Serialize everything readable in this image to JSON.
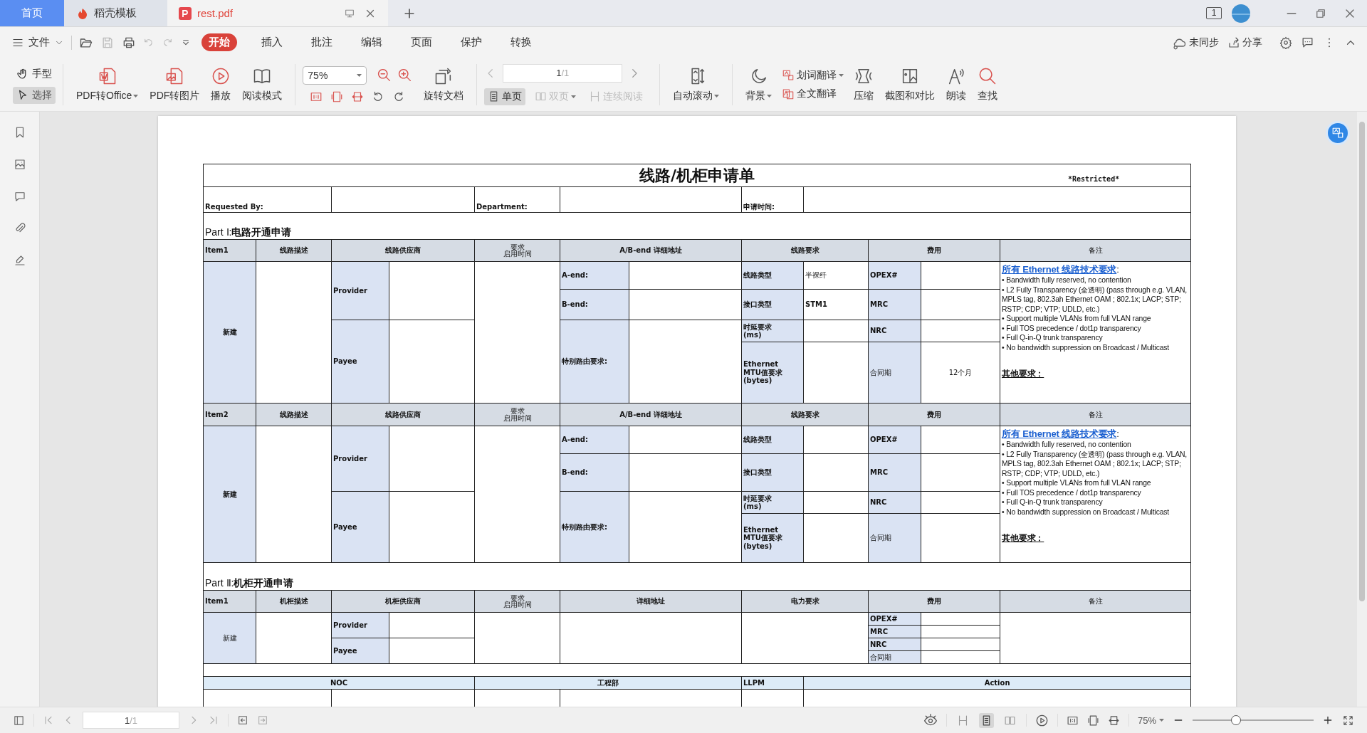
{
  "tabs": [
    {
      "label": "首页",
      "selected": false,
      "kind": "home"
    },
    {
      "label": "稻壳模板",
      "selected": false,
      "kind": "docer"
    },
    {
      "label": "rest.pdf",
      "selected": true,
      "kind": "pdf"
    }
  ],
  "title_bar": {
    "page_badge": "1"
  },
  "menu": {
    "file": "文件",
    "tabs": [
      {
        "label": "开始",
        "selected": true
      },
      {
        "label": "插入",
        "selected": false
      },
      {
        "label": "批注",
        "selected": false
      },
      {
        "label": "编辑",
        "selected": false
      },
      {
        "label": "页面",
        "selected": false
      },
      {
        "label": "保护",
        "selected": false
      },
      {
        "label": "转换",
        "selected": false
      }
    ],
    "sync": "未同步",
    "share": "分享"
  },
  "toolbar": {
    "pointer_tools": [
      {
        "label": "手型",
        "selected": false
      },
      {
        "label": "选择",
        "selected": true
      }
    ],
    "convert": [
      {
        "label": "PDF转Office",
        "dropdown": true
      },
      {
        "label": "PDF转图片",
        "dropdown": false
      },
      {
        "label": "播放",
        "dropdown": false
      },
      {
        "label": "阅读模式",
        "dropdown": false
      }
    ],
    "zoom": "75%",
    "rotate": "旋转文档",
    "page": {
      "current": "1",
      "total": "/1"
    },
    "view_modes": [
      {
        "label": "单页",
        "selected": true,
        "disabled": false,
        "dropdown": false
      },
      {
        "label": "双页",
        "selected": false,
        "disabled": true,
        "dropdown": true
      },
      {
        "label": "连续阅读",
        "selected": false,
        "disabled": true,
        "dropdown": false
      }
    ],
    "tools": [
      {
        "label": "自动滚动",
        "dropdown": true
      },
      {
        "label": "背景",
        "dropdown": true
      }
    ],
    "translate": [
      {
        "label": "划词翻译",
        "dropdown": true
      },
      {
        "label": "全文翻译",
        "dropdown": false
      }
    ],
    "more_tools": [
      {
        "label": "压缩"
      },
      {
        "label": "截图和对比"
      },
      {
        "label": "朗读"
      },
      {
        "label": "查找"
      }
    ]
  },
  "document": {
    "title": "线路/机柜申请单",
    "classification": "*Restricted*",
    "requested_by": "Requested By:",
    "department": "Department:",
    "request_time": "申请时间:",
    "part1_heading": "Part Ⅰ:**电路开通申请**",
    "circuit_items": [
      {
        "item": "Item1",
        "columns": [
          "线路描述",
          "线路供应商",
          "A/B-end 详细地址",
          "线路要求",
          "费用",
          "备注"
        ],
        "time_header": [
          "要求",
          "启用时间"
        ],
        "status": "新建",
        "provider": "Provider",
        "payee": "Payee",
        "a_end": "A-end:",
        "b_end": "B-end:",
        "routing": "特别路由要求:",
        "requirements": [
          {
            "label": "线路类型",
            "value": "半裸纤"
          },
          {
            "label": "接口类型",
            "value": "STM1"
          },
          {
            "label": "时延要求\n(ms)"
          },
          {
            "label": "Ethernet\nMTU值要求\n(bytes)"
          }
        ],
        "fees": [
          {
            "label": "OPEX#"
          },
          {
            "label": "MRC"
          },
          {
            "label": "NRC"
          },
          {
            "label": "合同期",
            "value": "12个月"
          }
        ],
        "remarks": {
          "link": "所有 Ethernet 线路技术要求",
          "link_suffix": ":",
          "bullets": [
            "• Bandwidth fully reserved, no contention",
            "• L2 Fully Transparency (全透明) (pass through e.g. VLAN, MPLS tag, 802.3ah Ethernet OAM ; 802.1x; LACP; STP; RSTP; CDP; VTP; UDLD, etc.)",
            "• Support multiple VLANs from full VLAN range",
            "• Full TOS precedence / dot1p transparency",
            "• Full Q-in-Q trunk transparency",
            "• No bandwidth suppression on Broadcast / Multicast"
          ],
          "other": "其他要求："
        }
      },
      {
        "item": "Item2",
        "columns": [
          "线路描述",
          "线路供应商",
          "A/B-end 详细地址",
          "线路要求",
          "费用",
          "备注"
        ],
        "time_header": [
          "要求",
          "启用时间"
        ],
        "status": "新建",
        "provider": "Provider",
        "payee": "Payee",
        "a_end": "A-end:",
        "b_end": "B-end:",
        "routing": "特别路由要求:",
        "requirements": [
          {
            "label": "线路类型"
          },
          {
            "label": "接口类型"
          },
          {
            "label": "时延要求\n(ms)"
          },
          {
            "label": "Ethernet\nMTU值要求\n(bytes)"
          }
        ],
        "fees": [
          {
            "label": "OPEX#"
          },
          {
            "label": "MRC"
          },
          {
            "label": "NRC"
          },
          {
            "label": "合同期"
          }
        ],
        "remarks": {
          "link": "所有 Ethernet 线路技术要求",
          "link_suffix": ":",
          "bullets": [
            "• Bandwidth fully reserved, no contention",
            "• L2 Fully Transparency (全透明) (pass through e.g. VLAN, MPLS tag, 802.3ah Ethernet OAM ; 802.1x; LACP; STP; RSTP; CDP; VTP; UDLD, etc.)",
            "• Support multiple VLANs from full VLAN range",
            "• Full TOS precedence / dot1p transparency",
            "• Full Q-in-Q trunk transparency",
            "• No bandwidth suppression on Broadcast / Multicast"
          ],
          "other": "其他要求："
        }
      }
    ],
    "part2_heading": "Part Ⅱ:**机柜开通申请**",
    "cabinet": {
      "item": "Item1",
      "columns": [
        "机柜描述",
        "机柜供应商",
        "详细地址",
        "电力要求",
        "费用",
        "备注"
      ],
      "time_header": [
        "要求",
        "启用时间"
      ],
      "status": "新建",
      "provider": "Provider",
      "payee": "Payee",
      "fees": [
        "OPEX#",
        "MRC",
        "NRC",
        "合同期"
      ]
    },
    "signoff": [
      "NOC",
      "工程部",
      "LLPM",
      "Action"
    ]
  },
  "status_bar": {
    "page": {
      "current": "1",
      "total": "/1"
    },
    "view_modes": [
      {
        "selected": false
      },
      {
        "selected": true
      },
      {
        "selected": false
      }
    ],
    "zoom": "75%",
    "zoom_slider": {
      "level": 0.36
    }
  }
}
